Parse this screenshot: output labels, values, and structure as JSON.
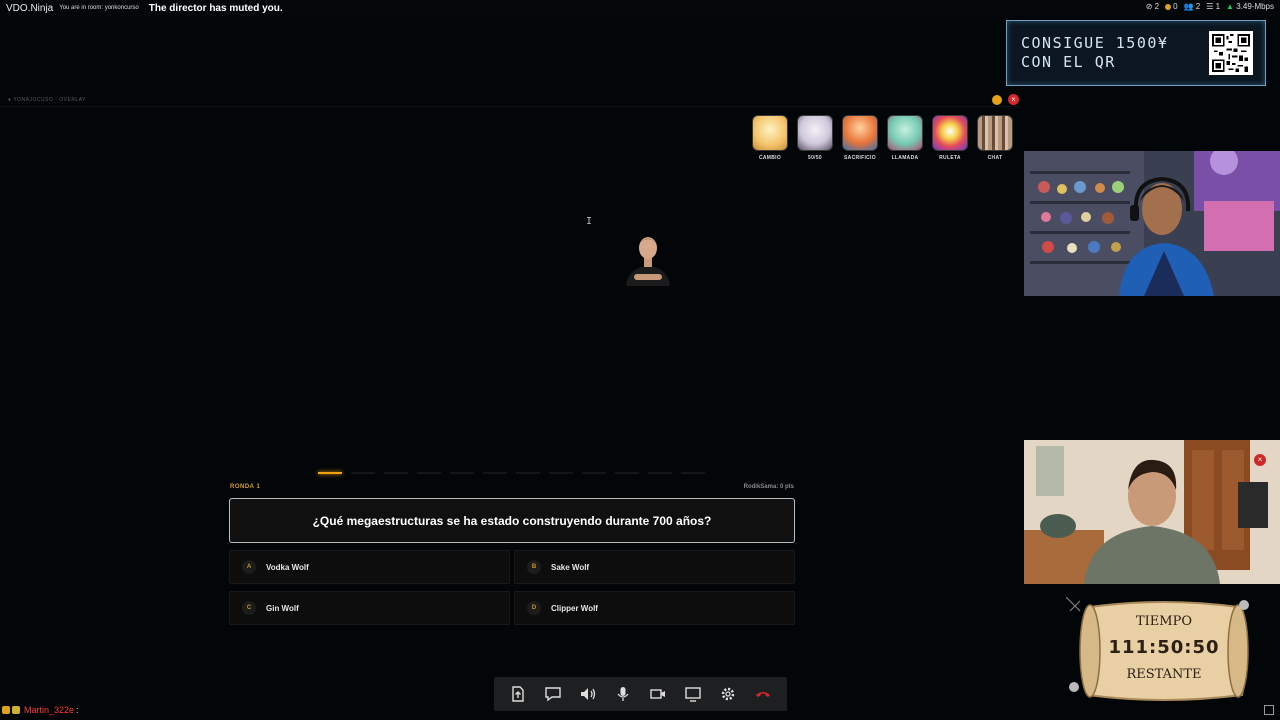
{
  "topbar": {
    "brand": "VDO.Ninja",
    "room_text": "You are in room: yonkoncurso",
    "muted_text": "The director has muted you.",
    "stats": [
      {
        "name": "link-count",
        "value": "2"
      },
      {
        "name": "mic-count",
        "value": "0"
      },
      {
        "name": "users-count",
        "value": "2"
      },
      {
        "name": "list-count",
        "value": "1"
      },
      {
        "name": "bitrate",
        "value": "3.49-Mbps"
      }
    ]
  },
  "promo": {
    "line1": "CONSIGUE 1500¥",
    "line2": "CON EL QR"
  },
  "overlay": {
    "label": "● YONAJOCUSO · OVERLAY"
  },
  "powerups": [
    {
      "label": "CAMBIO",
      "color": "#f2c36a"
    },
    {
      "label": "50/50",
      "color": "#cfc8da"
    },
    {
      "label": "SACRIFICIO",
      "color": "#e8743a"
    },
    {
      "label": "LLAMADA",
      "color": "#74c9b0"
    },
    {
      "label": "RULETA",
      "color": "#e44a5a"
    },
    {
      "label": "CHAT",
      "color": "#8a6a5a"
    }
  ],
  "game": {
    "round": "RONDA 1",
    "score": "RodikSama: 0 pts",
    "progress_active_index": 0,
    "progress_segments": 12,
    "question": "¿Qué megaestructuras se ha estado construyendo durante 700 años?",
    "answers": [
      {
        "letter": "A",
        "text": "Vodka Wolf"
      },
      {
        "letter": "B",
        "text": "Sake Wolf"
      },
      {
        "letter": "C",
        "text": "Gin Wolf"
      },
      {
        "letter": "D",
        "text": "Clipper Wolf"
      }
    ]
  },
  "timer": {
    "top": "TIEMPO",
    "clock": "111:50:50",
    "bottom": "RESTANTE"
  },
  "controls": [
    "share-file-icon",
    "chat-icon",
    "speaker-icon",
    "microphone-icon",
    "camera-icon",
    "screen-share-icon",
    "settings-icon",
    "hangup-icon"
  ],
  "chat": {
    "user": "Martin_322e",
    "separator": ":"
  },
  "colors": {
    "accent": "#f0a010",
    "danger": "#d8262b",
    "promo_border": "#6fa0bd"
  }
}
